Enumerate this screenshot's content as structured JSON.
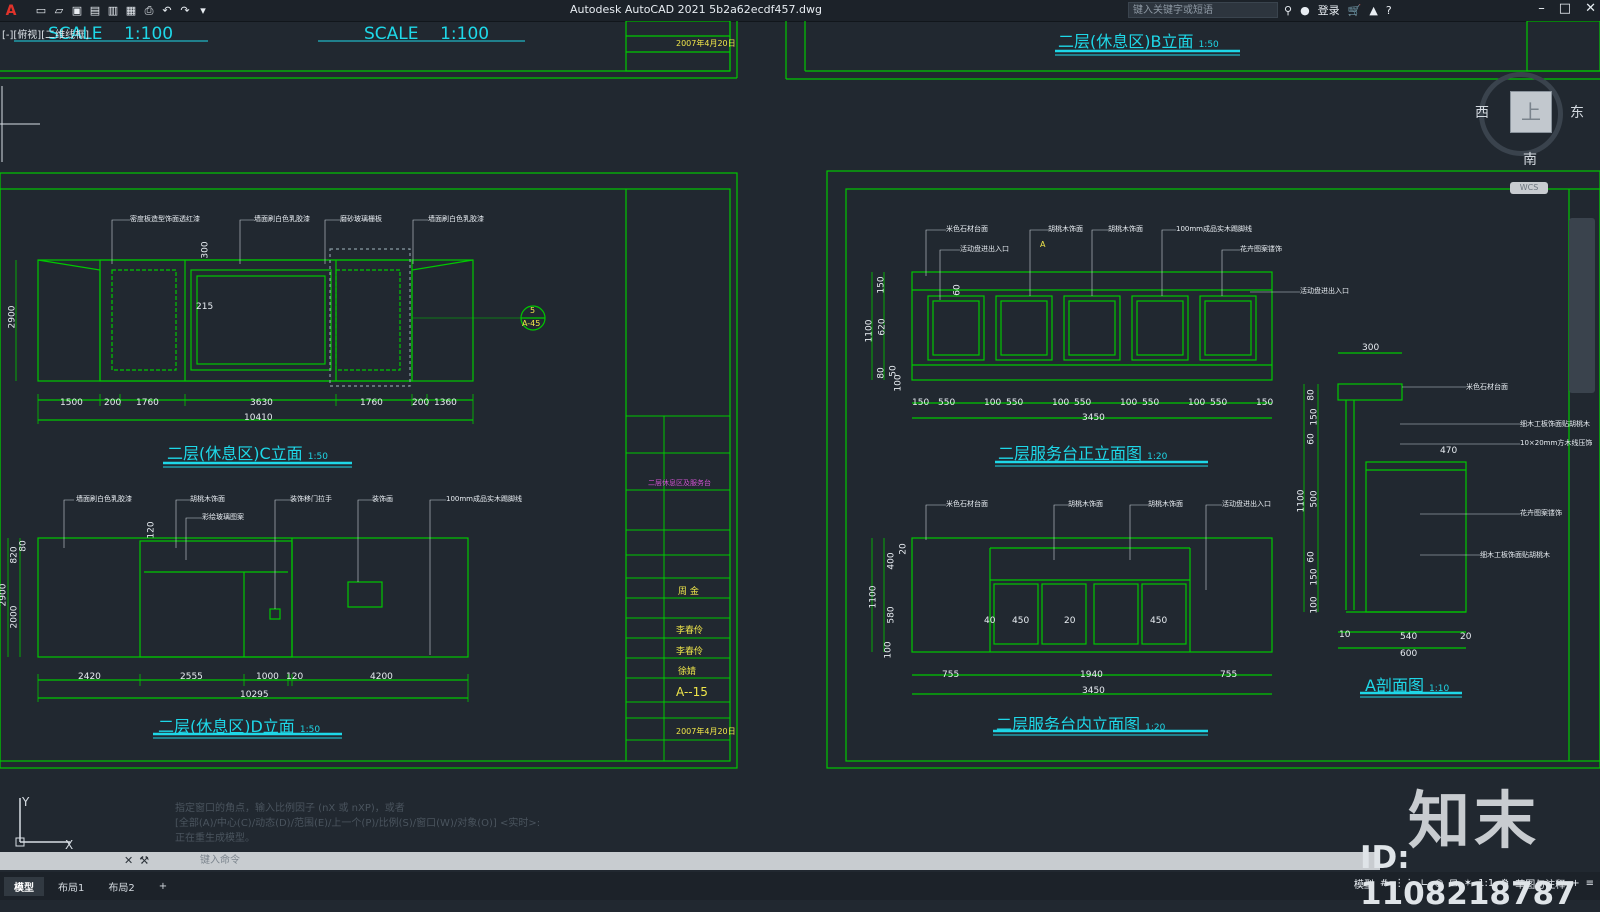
{
  "app": {
    "title": "Autodesk AutoCAD 2021    5b2a62ecdf457.dwg",
    "search_placeholder": "键入关键字或短语",
    "login": "登录",
    "viewport_label": "[-][俯视][二维线框]"
  },
  "scales": {
    "left": "SCALE    1:100",
    "mid": "SCALE    1:100"
  },
  "drawing": {
    "c_title": "二层(休息区)C立面",
    "c_scale": "1:50",
    "c_dims": [
      "1500",
      "200",
      "1760",
      "3630",
      "1760",
      "200",
      "1360"
    ],
    "c_total": "10410",
    "c_height": "2900",
    "c_h1": "300",
    "c_h2": "215",
    "c_notes": [
      "密度板造型饰面透红漆",
      "墙面刷白色乳胶漆",
      "磨砂玻璃栅板",
      "墙面刷白色乳胶漆"
    ],
    "c_marker_top": "5",
    "c_marker_bottom": "A-45",
    "d_title": "二层(休息区)D立面",
    "d_scale": "1:50",
    "d_dims": [
      "2420",
      "2555",
      "1000",
      "120",
      "4200"
    ],
    "d_total": "10295",
    "d_heights": [
      "2900",
      "2000",
      "820",
      "80"
    ],
    "d_h1": "120",
    "d_notes": [
      "墙面刷白色乳胶漆",
      "胡桃木饰面",
      "彩绘玻璃图案",
      "装饰移门拉手",
      "装饰画",
      "100mm成品实木踢脚线"
    ],
    "b_title": "二层(休息区)B立面",
    "b_scale": "1:50",
    "front_title": "二层服务台正立面图",
    "front_scale": "1:20",
    "front_dims": [
      "150",
      "550",
      "100",
      "550",
      "100",
      "550",
      "100",
      "550",
      "100",
      "550",
      "150"
    ],
    "front_total": "3450",
    "front_heights": [
      "1100",
      "150",
      "80",
      "620",
      "50",
      "100"
    ],
    "front_h60": "60",
    "front_mark": "A",
    "front_notes": [
      "米色石材台面",
      "活动盘进出入口",
      "胡桃木饰面",
      "胡桃木饰面",
      "100mm成品实木踢脚线",
      "花卉图案镂饰",
      "活动盘进出入口"
    ],
    "inner_title": "二层服务台内立面图",
    "inner_scale": "1:20",
    "inner_dims": [
      "755",
      "1940",
      "755"
    ],
    "inner_total": "3450",
    "inner_sub": [
      "40",
      "450",
      "20",
      "450"
    ],
    "inner_heights": [
      "1100",
      "400",
      "580",
      "100",
      "20"
    ],
    "inner_notes": [
      "米色石材台面",
      "胡桃木饰面",
      "胡桃木饰面",
      "活动盘进出入口"
    ],
    "section_title": "A剖面图",
    "section_scale": "1:10",
    "section_dims": [
      "300",
      "470",
      "10",
      "540",
      "20",
      "600"
    ],
    "section_heights": [
      "1100",
      "80",
      "150",
      "60",
      "500",
      "60",
      "150",
      "100"
    ],
    "section_notes": [
      "米色石材台面",
      "细木工板饰面贴胡桃木",
      "10×20mm方木线压饰",
      "花卉图案镂饰",
      "细木工板饰面贴胡桃木"
    ]
  },
  "titleblock": {
    "date": "2007年4月20日",
    "checked": "周 金",
    "designer": "李春伶",
    "drawer": "李春伶",
    "approve": "徐婧",
    "sheet": "A--15",
    "project": "二层休息区及服务台"
  },
  "compass": {
    "west": "西",
    "east": "东",
    "south": "南",
    "top": "上",
    "wcs": "WCS"
  },
  "ucs": {
    "y": "Y",
    "x": "X"
  },
  "command": {
    "history": [
      "指定窗口的角点，输入比例因子 (nX 或 nXP)，或者",
      "[全部(A)/中心(C)/动态(D)/范围(E)/上一个(P)/比例(S)/窗口(W)/对象(O)] <实时>:",
      "正在重生成模型。"
    ],
    "placeholder": "键入命令"
  },
  "tabs": [
    "模型",
    "布局1",
    "布局2"
  ],
  "status": {
    "model": "模型",
    "scale": "1:1",
    "workspace": "草图与注释"
  },
  "watermark": {
    "logo": "知末",
    "id": "ID: 1108218787"
  }
}
